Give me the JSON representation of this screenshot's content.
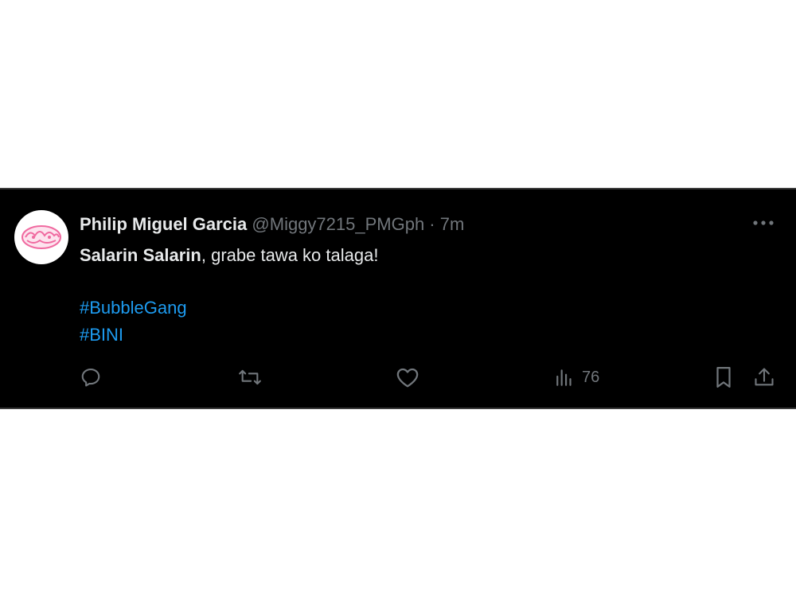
{
  "tweet": {
    "display_name": "Philip Miguel Garcia",
    "handle": "@Miggy7215_PMGph",
    "separator": " · ",
    "time": "7m",
    "body_bold": "Salarin Salarin",
    "body_rest": ", grabe tawa ko talaga!",
    "hashtags": [
      "#BubbleGang",
      "#BINI"
    ],
    "views": "76"
  },
  "colors": {
    "background": "#000000",
    "name": "#e7e9ea",
    "muted": "#71767b",
    "hashtag": "#1d9bf0",
    "avatar_accent": "#f06aa0"
  },
  "icons": {
    "avatar": "avatar-logo",
    "more": "more-icon",
    "reply": "reply-icon",
    "repost": "repost-icon",
    "like": "like-icon",
    "views": "views-icon",
    "bookmark": "bookmark-icon",
    "share": "share-icon"
  }
}
